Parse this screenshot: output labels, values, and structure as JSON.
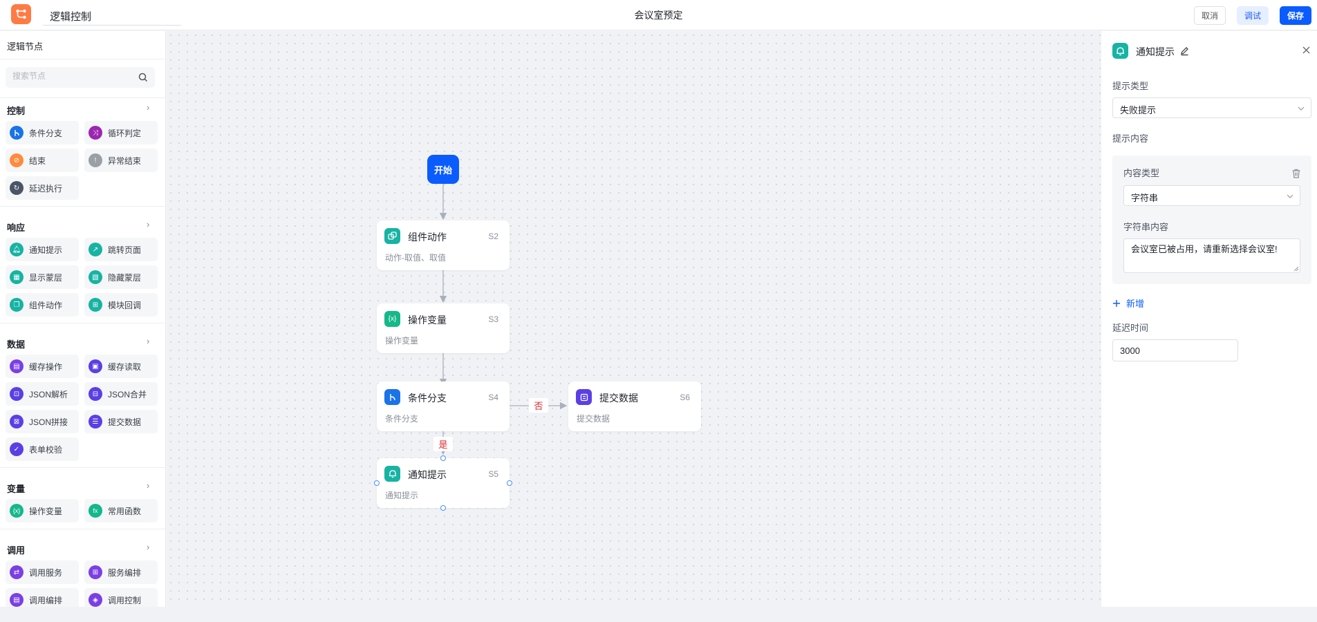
{
  "topbar": {
    "app_title": "逻辑控制",
    "page_title": "会议室预定",
    "cancel_label": "取消",
    "debug_label": "调试",
    "save_label": "保存"
  },
  "sidebar": {
    "header": "逻辑节点",
    "search_placeholder": "搜索节点",
    "sections": [
      {
        "title": "控制",
        "items": [
          {
            "label": "条件分支",
            "icon": "branch-icon",
            "color": "#1a73e8"
          },
          {
            "label": "循环判定",
            "icon": "loop-icon",
            "color": "#9c27b0"
          },
          {
            "label": "结束",
            "icon": "end-icon",
            "color": "#ff8a3d"
          },
          {
            "label": "异常结束",
            "icon": "exception-icon",
            "color": "#9aa0a6"
          },
          {
            "label": "延迟执行",
            "icon": "delay-icon",
            "color": "#4a5568"
          }
        ]
      },
      {
        "title": "响应",
        "items": [
          {
            "label": "通知提示",
            "icon": "bell-icon",
            "color": "#17b3a3"
          },
          {
            "label": "跳转页面",
            "icon": "jump-icon",
            "color": "#17b3a3"
          },
          {
            "label": "显示蒙层",
            "icon": "show-mask-icon",
            "color": "#17b3a3"
          },
          {
            "label": "隐藏蒙层",
            "icon": "hide-mask-icon",
            "color": "#17b3a3"
          },
          {
            "label": "组件动作",
            "icon": "component-action-icon",
            "color": "#17b3a3"
          },
          {
            "label": "模块回调",
            "icon": "module-callback-icon",
            "color": "#17b3a3"
          }
        ]
      },
      {
        "title": "数据",
        "items": [
          {
            "label": "缓存操作",
            "icon": "cache-op-icon",
            "color": "#7b3fe4"
          },
          {
            "label": "缓存读取",
            "icon": "cache-read-icon",
            "color": "#5b3fe4"
          },
          {
            "label": "JSON解析",
            "icon": "json-parse-icon",
            "color": "#5b3fe4"
          },
          {
            "label": "JSON合并",
            "icon": "json-merge-icon",
            "color": "#5b3fe4"
          },
          {
            "label": "JSON拼接",
            "icon": "json-concat-icon",
            "color": "#5b3fe4"
          },
          {
            "label": "提交数据",
            "icon": "submit-data-icon",
            "color": "#5b3fe4"
          },
          {
            "label": "表单校验",
            "icon": "form-validate-icon",
            "color": "#5b3fe4"
          }
        ]
      },
      {
        "title": "变量",
        "items": [
          {
            "label": "操作变量",
            "icon": "variable-icon",
            "color": "#14b88a"
          },
          {
            "label": "常用函数",
            "icon": "function-icon",
            "color": "#14b88a"
          }
        ]
      },
      {
        "title": "调用",
        "items": [
          {
            "label": "调用服务",
            "icon": "call-service-icon",
            "color": "#7b3fe4"
          },
          {
            "label": "服务编排",
            "icon": "service-orchestration-icon",
            "color": "#7b3fe4"
          },
          {
            "label": "调用编排",
            "icon": "call-orchestration-icon",
            "color": "#7b3fe4"
          },
          {
            "label": "调用控制",
            "icon": "call-control-icon",
            "color": "#7b3fe4"
          }
        ]
      }
    ]
  },
  "canvas": {
    "start_label": "开始",
    "nodes": [
      {
        "title": "组件动作",
        "id": "S2",
        "desc": "动作-取值、取值",
        "icon": "component-action-icon",
        "color": "#17b3a3"
      },
      {
        "title": "操作变量",
        "id": "S3",
        "desc": "操作变量",
        "icon": "variable-icon",
        "color": "#14b88a"
      },
      {
        "title": "条件分支",
        "id": "S4",
        "desc": "条件分支",
        "icon": "branch-icon",
        "color": "#1a73e8"
      },
      {
        "title": "通知提示",
        "id": "S5",
        "desc": "通知提示",
        "icon": "bell-icon",
        "color": "#17b3a3"
      },
      {
        "title": "提交数据",
        "id": "S6",
        "desc": "提交数据",
        "icon": "submit-data-icon",
        "color": "#5b3fe4"
      }
    ],
    "edge_labels": {
      "no": "否",
      "yes": "是"
    }
  },
  "panel": {
    "title": "通知提示",
    "tip_type_label": "提示类型",
    "tip_type_value": "失败提示",
    "tip_content_label": "提示内容",
    "content_type_label": "内容类型",
    "content_type_value": "字符串",
    "string_content_label": "字符串内容",
    "string_content_value": "会议室已被占用，请重新选择会议室!",
    "add_label": "新增",
    "delay_label": "延迟时间",
    "delay_value": "3000"
  },
  "colors": {
    "primary": "#0b5cff",
    "teal": "#17b3a3",
    "danger": "#e0282e",
    "logo": "#ff7a45"
  }
}
